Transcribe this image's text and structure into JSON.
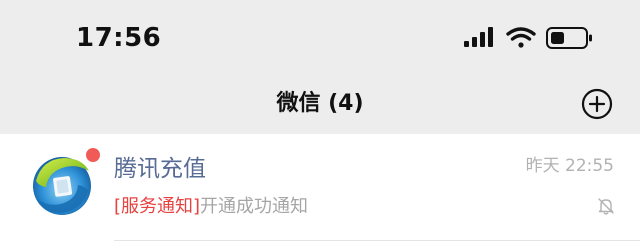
{
  "status_bar": {
    "time": "17:56",
    "icons": [
      "cellular-signal-icon",
      "wifi-icon",
      "battery-icon"
    ]
  },
  "nav": {
    "title": "微信 (4)",
    "add_icon": "plus-circle-icon"
  },
  "chats": [
    {
      "name": "腾讯充值",
      "time": "昨天 22:55",
      "preview_tag": "[服务通知]",
      "preview_text": "开通成功通知",
      "unread": true,
      "muted": true,
      "avatar_icon": "tencent-recharge-logo"
    }
  ],
  "colors": {
    "background": "#ededed",
    "list_background": "#ffffff",
    "name": "#576b95",
    "tag": "#e64340",
    "unread_dot": "#f05b57",
    "secondary_text": "#b2b2b2"
  }
}
